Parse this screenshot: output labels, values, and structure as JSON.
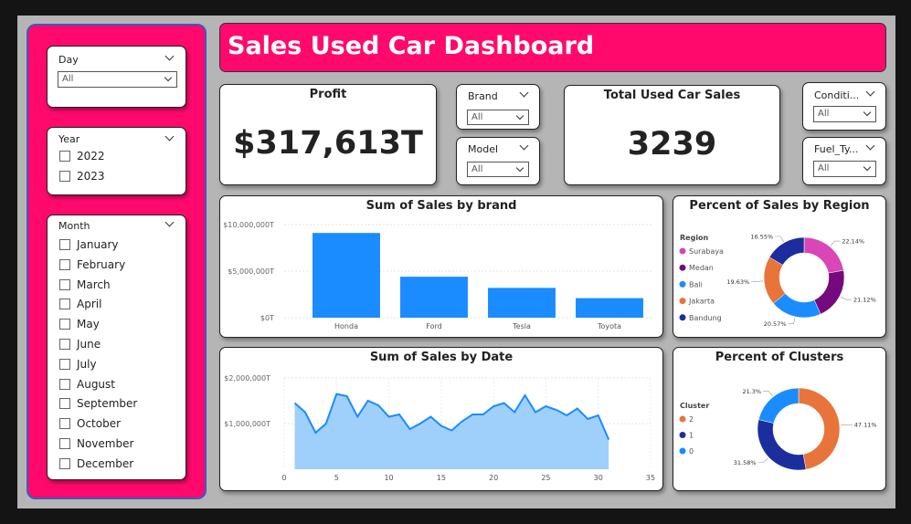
{
  "title": "Sales Used Car Dashboard",
  "colors": {
    "accent": "#ff0a6c",
    "bar": "#1a8cff",
    "area_line": "#1a8cff",
    "area_fill": "#9fd0fb"
  },
  "slicers": {
    "day": {
      "title": "Day",
      "value": "All"
    },
    "year": {
      "title": "Year",
      "options": [
        "2022",
        "2023"
      ]
    },
    "month": {
      "title": "Month",
      "options": [
        "January",
        "February",
        "March",
        "April",
        "May",
        "June",
        "July",
        "August",
        "September",
        "October",
        "November",
        "December"
      ]
    },
    "brand": {
      "title": "Brand",
      "value": "All"
    },
    "model": {
      "title": "Model",
      "value": "All"
    },
    "condition": {
      "title": "Conditi...",
      "value": "All"
    },
    "fuel_type": {
      "title": "Fuel_Ty...",
      "value": "All"
    }
  },
  "kpis": {
    "profit": {
      "title": "Profit",
      "value": "$317,613T"
    },
    "total_sales": {
      "title": "Total Used Car Sales",
      "value": "3239"
    }
  },
  "chart_data": [
    {
      "type": "bar",
      "title": "Sum of Sales by brand",
      "categories": [
        "Honda",
        "Ford",
        "Tesla",
        "Toyota"
      ],
      "values": [
        9100000,
        4400000,
        3200000,
        2100000
      ],
      "ylim": [
        0,
        10000000
      ],
      "yticks": [
        0,
        5000000,
        10000000
      ],
      "ytick_labels": [
        "$0T",
        "$5,000,000T",
        "$10,000,000T"
      ]
    },
    {
      "type": "pie",
      "title": "Percent of Sales by Region",
      "legend_title": "Region",
      "legend_position": "left",
      "slices": [
        {
          "label": "Surabaya",
          "value": 22.14,
          "text": "22.14%",
          "color": "#d946b8"
        },
        {
          "label": "Medan",
          "value": 21.12,
          "text": "21.12%",
          "color": "#740a7e"
        },
        {
          "label": "Bali",
          "value": 20.57,
          "text": "20.57%",
          "color": "#1a8cff"
        },
        {
          "label": "Jakarta",
          "value": 19.63,
          "text": "19.63%",
          "color": "#e8743b"
        },
        {
          "label": "Bandung",
          "value": 16.55,
          "text": "16.55%",
          "color": "#1c2e9e"
        }
      ]
    },
    {
      "type": "area",
      "title": "Sum of Sales by Date",
      "x": [
        1,
        2,
        3,
        4,
        5,
        6,
        7,
        8,
        9,
        10,
        11,
        12,
        13,
        14,
        15,
        16,
        17,
        18,
        19,
        20,
        21,
        22,
        23,
        24,
        25,
        26,
        27,
        28,
        29,
        30,
        31
      ],
      "y": [
        1450000,
        1250000,
        800000,
        1000000,
        1650000,
        1600000,
        1150000,
        1500000,
        1400000,
        1150000,
        1200000,
        880000,
        1000000,
        1150000,
        950000,
        850000,
        1050000,
        1200000,
        1200000,
        1380000,
        1450000,
        1250000,
        1620000,
        1250000,
        1380000,
        1300000,
        1180000,
        1330000,
        1100000,
        1180000,
        650000
      ],
      "xlim": [
        0,
        35
      ],
      "xticks": [
        0,
        5,
        10,
        15,
        20,
        25,
        30,
        35
      ],
      "ylim": [
        0,
        2000000
      ],
      "yticks": [
        1000000,
        2000000
      ],
      "ytick_labels": [
        "$1,000,000T",
        "$2,000,000T"
      ]
    },
    {
      "type": "pie",
      "title": "Percent of Clusters",
      "legend_title": "Cluster",
      "legend_position": "left",
      "slices": [
        {
          "label": "2",
          "value": 47.11,
          "text": "47.11%",
          "color": "#e8743b"
        },
        {
          "label": "1",
          "value": 31.58,
          "text": "31.58%",
          "color": "#1c2e9e"
        },
        {
          "label": "0",
          "value": 21.3,
          "text": "21.3%",
          "color": "#1a8cff"
        }
      ]
    }
  ]
}
